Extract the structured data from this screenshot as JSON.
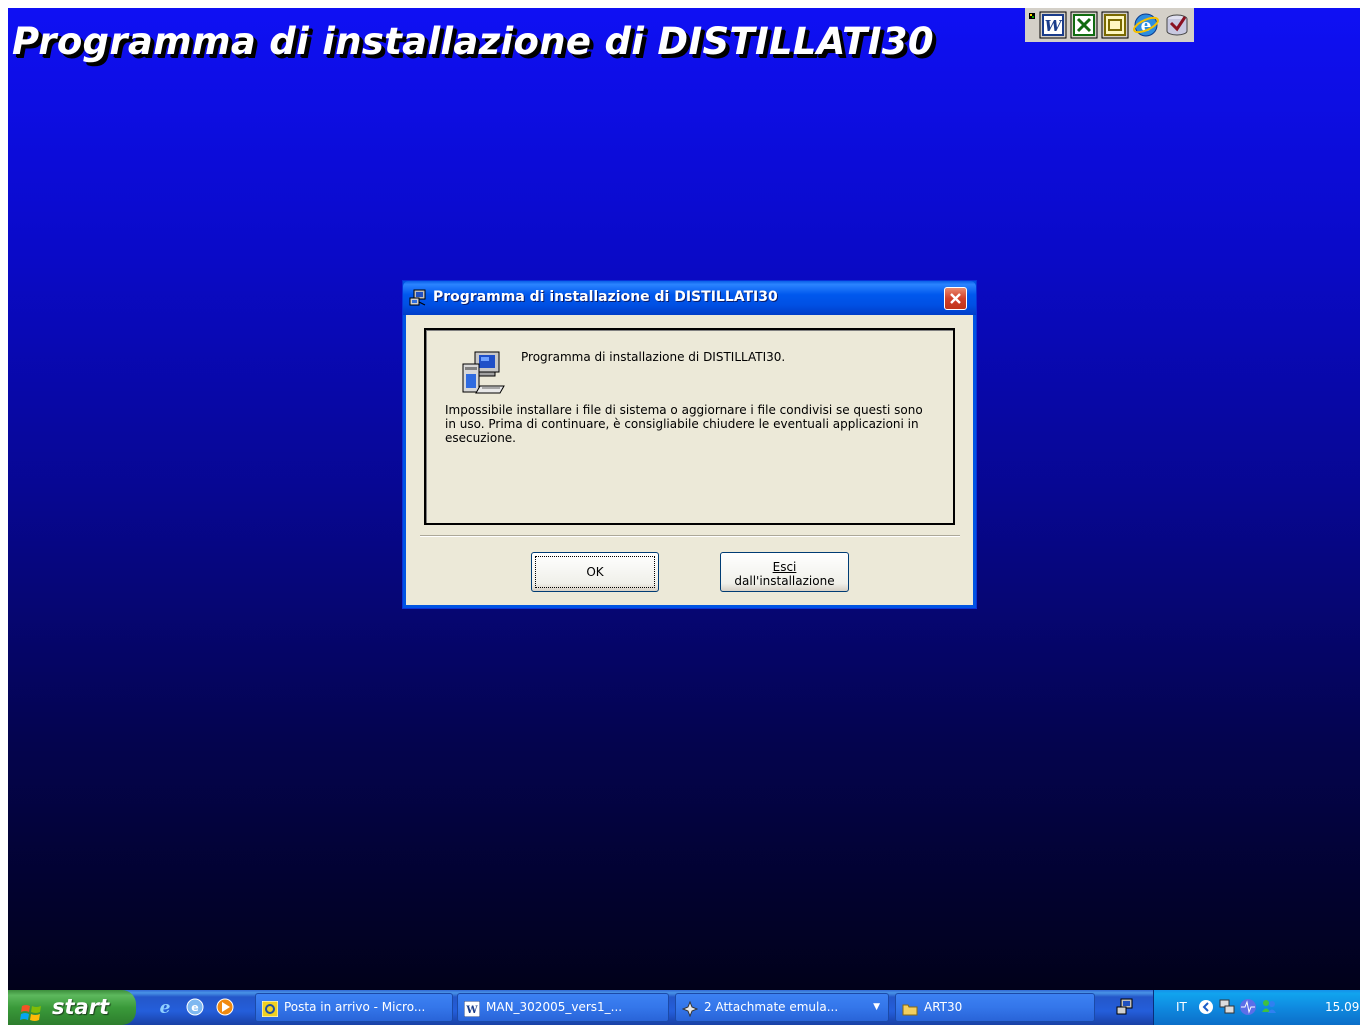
{
  "banner": {
    "title": "Programma di installazione di DISTILLATI30"
  },
  "office_toolbar": {
    "icons": [
      "word-icon",
      "excel-icon",
      "outlook-icon",
      "internet-explorer-icon",
      "access-icon"
    ]
  },
  "dialog": {
    "title": "Programma di installazione di DISTILLATI30",
    "heading": "Programma di installazione di DISTILLATI30.",
    "body": "Impossibile installare i file di sistema o aggiornare i file condivisi se questi sono in uso. Prima di continuare, è consigliabile chiudere le eventuali applicazioni in esecuzione.",
    "ok_label": "OK",
    "exit_label_line1": "Esci",
    "exit_label_line2": "dall'installazione"
  },
  "taskbar": {
    "start_label": "start",
    "tasks": [
      {
        "label": "Posta in arrivo - Micro...",
        "icon": "outlook-icon"
      },
      {
        "label": "MAN_302005_vers1_...",
        "icon": "word-icon"
      },
      {
        "label": "2 Attachmate emula...",
        "icon": "attachmate-icon"
      },
      {
        "label": "ART30",
        "icon": "folder-icon"
      }
    ],
    "tray": {
      "language": "IT",
      "clock": "15.09"
    }
  },
  "colors": {
    "desktop_top": "#0f10f4",
    "desktop_bottom": "#01011a",
    "titlebar": "#0058ee",
    "dialog_bg": "#ece9d8",
    "taskbar": "#245edb",
    "start_button": "#3a9a3a"
  }
}
